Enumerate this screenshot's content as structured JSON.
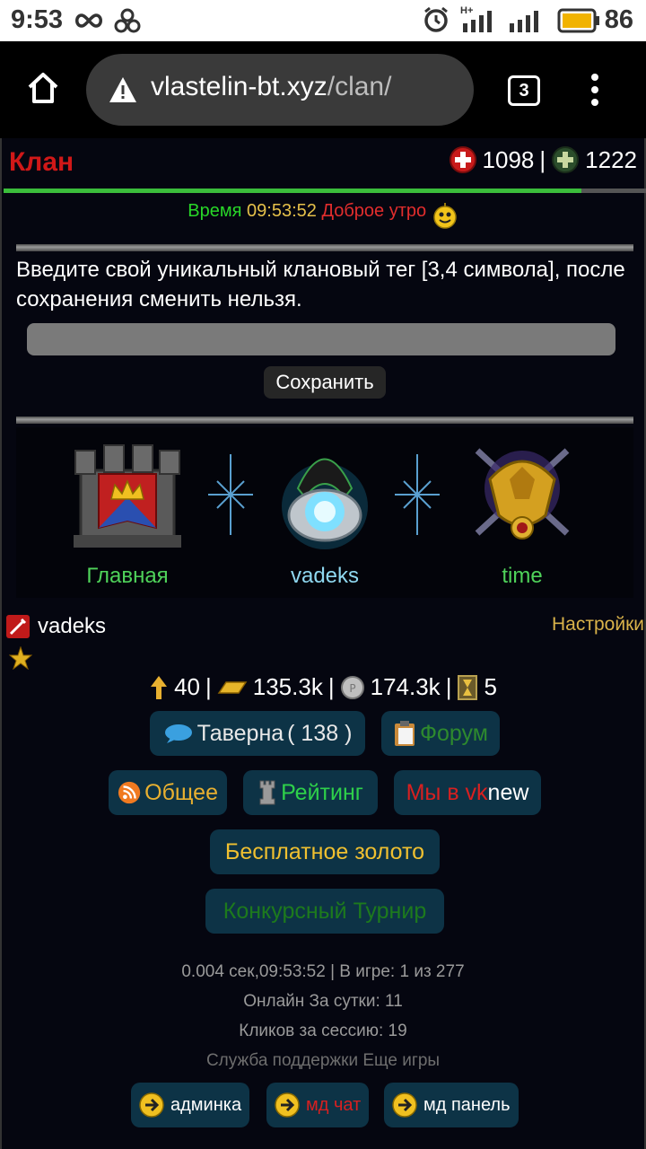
{
  "status_bar": {
    "time": "9:53",
    "network": "H+",
    "battery_percent": "86"
  },
  "browser": {
    "url_domain": "vlastelin-bt.xyz",
    "url_path": "/clan/",
    "tab_count": "3"
  },
  "page": {
    "title": "Клан",
    "hp": "1098",
    "separator": "|",
    "mana": "1222",
    "hp_fraction": 0.9,
    "time_label": "Время",
    "time_value": "09:53:52",
    "greeting": "Доброе утро",
    "notice": "Введите свой уникальный клановый тег [3,4 символа], после сохранения сменить нельзя.",
    "tag_placeholder": "",
    "save_label": "Сохранить"
  },
  "banner": {
    "items": [
      {
        "label": "Главная"
      },
      {
        "label": "vadeks"
      },
      {
        "label": "time"
      }
    ]
  },
  "user": {
    "name": "vadeks",
    "settings_label": "Настройки"
  },
  "resources": {
    "level": "40",
    "gold": "135.3k",
    "silver": "174.3k",
    "keys": "5",
    "sep": "|"
  },
  "nav": {
    "tavern_label": "Таверна",
    "tavern_count": "( 138 )",
    "forum_label": "Форум",
    "general_label": "Общее",
    "rating_label": "Рейтинг",
    "vk_prefix": "Мы в vk",
    "vk_new": "new",
    "free_gold_label": "Бесплатное золото",
    "tournament_label": "Конкурсный Турнир"
  },
  "footer": {
    "stats_line": "0.004 сек,09:53:52 | В игре: 1 из 277",
    "online_line": "Онлайн За сутки: 11",
    "clicks_line": "Кликов за сессию: 19",
    "support_label": "Служба поддержки",
    "more_games_label": "Еще игры",
    "admin_label": "админка",
    "mdchat_label": "мд чат",
    "mdpanel_label": "мд панель"
  },
  "colors": {
    "title_red": "#d01818",
    "button_bg": "#0d3346",
    "gold_text": "#e5c04a",
    "green_text": "#28d628"
  }
}
